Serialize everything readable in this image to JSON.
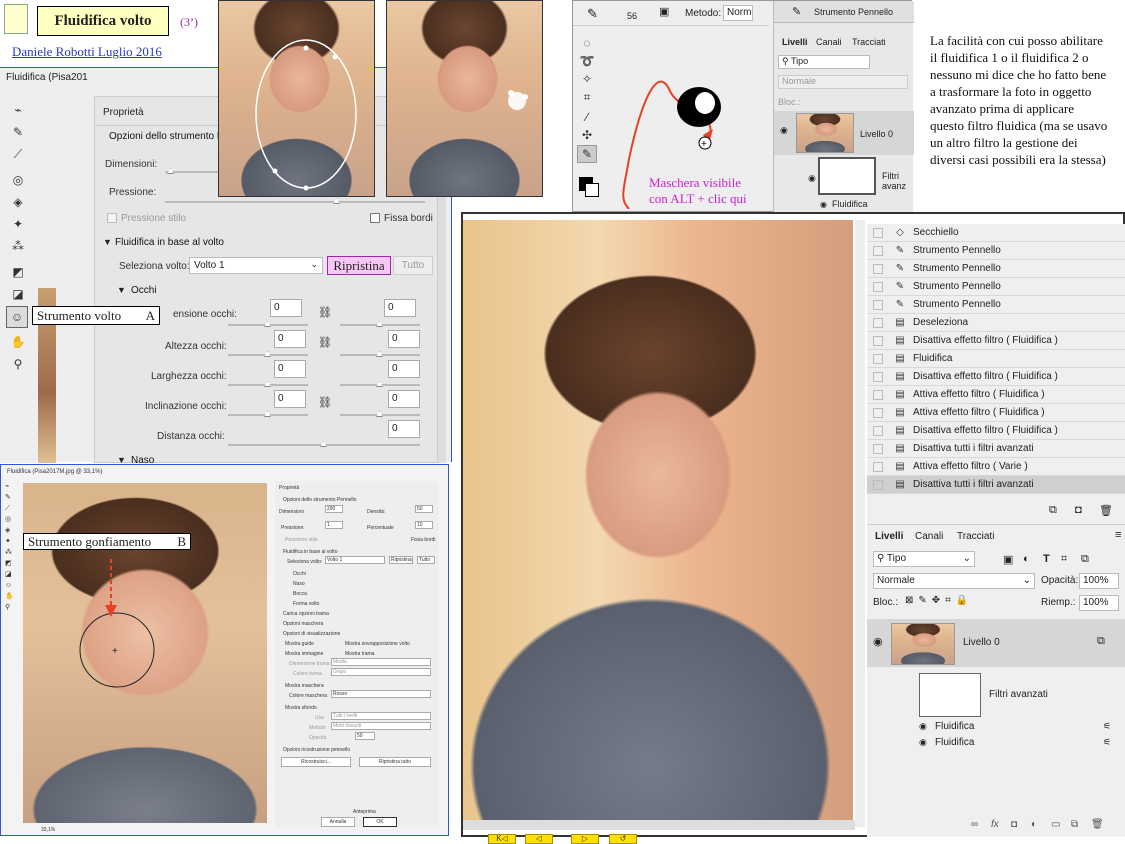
{
  "header": {
    "title": "Fluidifica volto",
    "duration": "(3’)",
    "author_link": "Daniele Robotti Luglio 2016"
  },
  "liquify_main": {
    "window_title": "Fluidifica (Pisa201",
    "properties_tab": "Proprietà",
    "brush_options": "Opzioni dello strumento P",
    "dimension_label": "Dimensioni:",
    "pressure_label": "Pressione:",
    "stylus_pressure": "Pressione stilo",
    "pin_edges": "Fissa bordi",
    "face_aware": "Fluidifica in base al volto",
    "select_face_label": "Seleziona volto:",
    "select_face_value": "Volto 1",
    "reset_button": "Ripristina",
    "all_button": "Tutto",
    "eyes_section": "Occhi",
    "eye_size": "ensione occhi:",
    "eye_height": "Altezza occhi:",
    "eye_width": "Larghezza occhi:",
    "eye_tilt": "Inclinazione occhi:",
    "eye_distance": "Distanza occhi:",
    "nose_section": "Naso",
    "field_values": [
      "0",
      "0",
      "0",
      "0",
      "0",
      "0",
      "0",
      "0",
      "0"
    ],
    "face_tool_callout": "Strumento volto",
    "face_tool_letter": "A"
  },
  "toolbar_panel": {
    "blend_label": "Metodo:",
    "blend_value": "Norma",
    "brush_size": "56",
    "layer_thumb_label": "Strumento Pennello",
    "tabs": [
      "Livelli",
      "Canali",
      "Tracciati"
    ],
    "kind_value": "Tipo",
    "normal_value": "Normale",
    "lock_label": "Bloc.:",
    "layer_name": "Livello 0",
    "smart_filters": "Filtri avanz",
    "filter_name": "Fluidifica",
    "mask_caption_1": "Maschera visibile",
    "mask_caption_2": "con ALT + clic qui"
  },
  "note": {
    "text": "La facilità con cui posso abilitare il fluidifica 1 o il fluidifica 2 o nessuno mi dice che ho fatto bene a trasformare la foto in oggetto avanzato prima di applicare questo filtro fluidica  (ma se usavo un altro filtro la gestione dei diversi casi possibili era la stessa)"
  },
  "history": {
    "items": [
      {
        "icon": "bucket-icon",
        "label": "Secchiello"
      },
      {
        "icon": "brush-icon",
        "label": "Strumento Pennello"
      },
      {
        "icon": "brush-icon",
        "label": "Strumento Pennello"
      },
      {
        "icon": "brush-icon",
        "label": "Strumento Pennello"
      },
      {
        "icon": "brush-icon",
        "label": "Strumento Pennello"
      },
      {
        "icon": "doc-icon",
        "label": "Deseleziona"
      },
      {
        "icon": "doc-icon",
        "label": "Disattiva effetto filtro ( Fluidifica )"
      },
      {
        "icon": "doc-icon",
        "label": "Fluidifica"
      },
      {
        "icon": "doc-icon",
        "label": "Disattiva effetto filtro ( Fluidifica )"
      },
      {
        "icon": "doc-icon",
        "label": "Attiva effetto filtro ( Fluidifica )"
      },
      {
        "icon": "doc-icon",
        "label": "Attiva effetto filtro ( Fluidifica )"
      },
      {
        "icon": "doc-icon",
        "label": "Disattiva effetto filtro ( Fluidifica )"
      },
      {
        "icon": "doc-icon",
        "label": "Disattiva tutti i filtri avanzati"
      },
      {
        "icon": "doc-icon",
        "label": "Attiva effetto filtro ( Varie )"
      },
      {
        "icon": "doc-icon",
        "label": "Disattiva tutti i filtri avanzati"
      }
    ]
  },
  "layers": {
    "tabs": [
      "Livelli",
      "Canali",
      "Tracciati"
    ],
    "kind_value": "Tipo",
    "blend_value": "Normale",
    "opacity_label": "Opacità:",
    "opacity_value": "100%",
    "lock_label": "Bloc.:",
    "fill_label": "Riemp.:",
    "fill_value": "100%",
    "layer_name": "Livello 0",
    "smart_filters": "Filtri avanzati",
    "filters": [
      "Fluidifica",
      "Fluidifica"
    ]
  },
  "liquify_small": {
    "window_title": "Fluidifica (Pisa2017M.jpg @ 33,1%)",
    "properties": "Proprietà",
    "brush_opts": "Opzioni dello strumento Pennello",
    "dim": "Dimensioni",
    "dim_val": "290",
    "dens": "Densità:",
    "dens_val": "50",
    "press": "Pressione:",
    "press_val": "1",
    "rate": "Percentuale",
    "rate_val": "10",
    "stylus": "Pressione stilo",
    "pin": "Fissa bordi",
    "face_aware": "Fluidifica in base al volto",
    "select_face": "Seleziona volto:",
    "select_face_value": "Volto 1",
    "reset": "Ripristina",
    "all": "Tutto",
    "subs": [
      "Occhi",
      "Naso",
      "Bocca",
      "Forma volto"
    ],
    "load_mesh": "Carica opzioni trama",
    "mask_opts": "Opzioni maschera",
    "view_opts": "Opzioni di visualizzazione",
    "show_guides": "Mostra guide",
    "show_face": "Mostra sovrapposizione volto",
    "show_image": "Mostra immagine",
    "show_mesh": "Mostra trama",
    "mesh_size": "Dimensione trama",
    "mesh_size_val": "Media",
    "mesh_color": "Colore trama",
    "mesh_color_val": "Grigio",
    "show_mask": "Mostra maschera",
    "mask_color": "Colore maschera",
    "mask_color_val": "Rosso",
    "show_backdrop": "Mostra sfondo",
    "use": "Usa",
    "use_val": "Tutti i livelli",
    "mode": "Metodo",
    "mode_val": "Metti davanti",
    "opacity": "Opacità",
    "opacity_val": "50",
    "brush_rebuild": "Opzioni ricostruzione pennello",
    "rebuild": "Ricostruisci...",
    "restore_all": "Ripristina tutto",
    "preview": "Anteprima",
    "cancel": "Annulla",
    "ok": "OK",
    "zoom": "33,1%",
    "callout": "Strumento gonfiamento",
    "callout_letter": "B"
  },
  "nav": {
    "buttons": [
      "K◁",
      "◁",
      "▷",
      "↺"
    ]
  }
}
